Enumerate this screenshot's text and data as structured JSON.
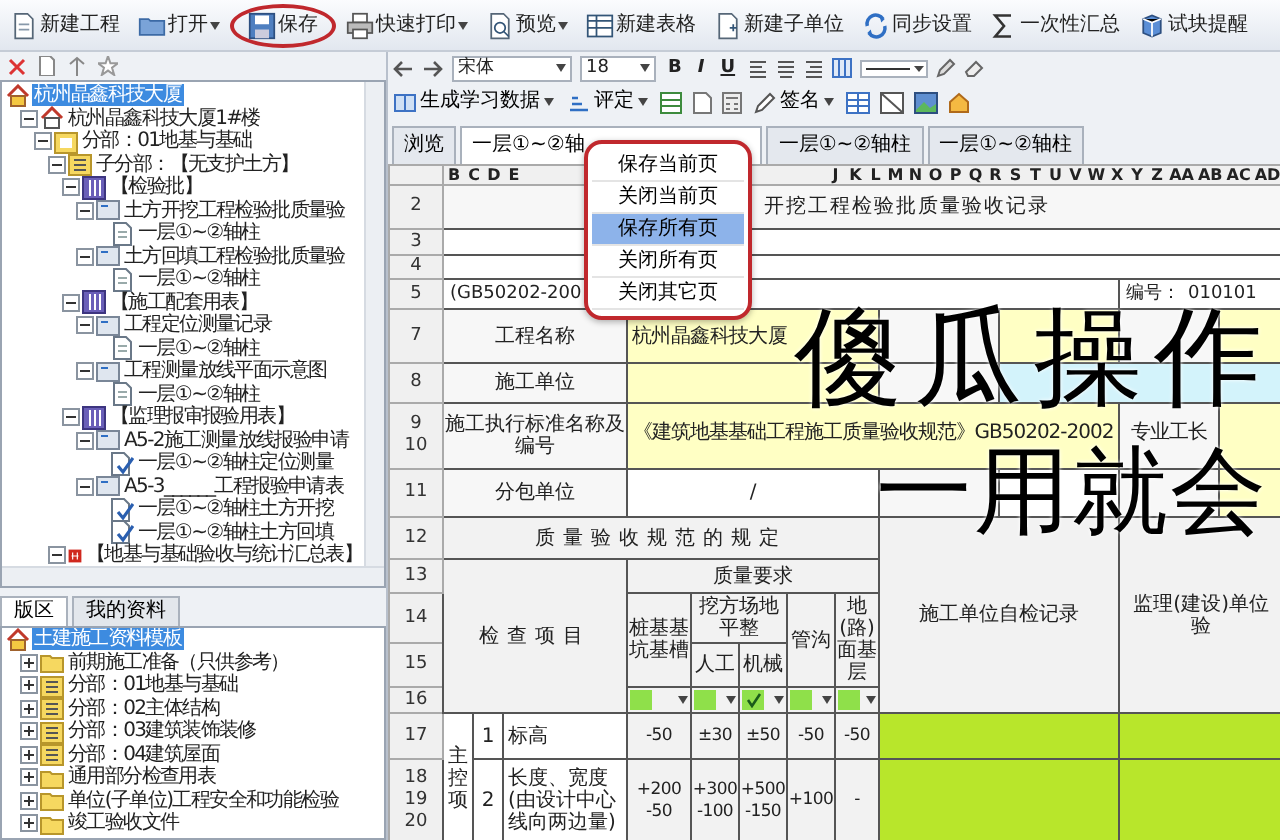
{
  "toolbar": [
    {
      "kind": "new-project",
      "label": "新建工程",
      "dropdown": false,
      "selected": false
    },
    {
      "kind": "open",
      "label": "打开",
      "dropdown": true,
      "selected": false
    },
    {
      "kind": "save",
      "label": "保存",
      "dropdown": false,
      "selected": true
    },
    {
      "kind": "print",
      "label": "快速打印",
      "dropdown": true,
      "selected": false
    },
    {
      "kind": "preview",
      "label": "预览",
      "dropdown": true,
      "selected": false
    },
    {
      "kind": "new-table",
      "label": "新建表格",
      "dropdown": false,
      "selected": false
    },
    {
      "kind": "new-unit",
      "label": "新建子单位",
      "dropdown": false,
      "selected": false
    },
    {
      "kind": "sync",
      "label": "同步设置",
      "dropdown": false,
      "selected": false
    },
    {
      "kind": "sum",
      "label": "一次性汇总",
      "dropdown": false,
      "selected": false
    },
    {
      "kind": "reminder",
      "label": "试块提醒",
      "dropdown": false,
      "selected": false
    }
  ],
  "format_bar": {
    "font": "宋体",
    "size": "18",
    "style_buttons": [
      "B",
      "I",
      "U"
    ]
  },
  "action_bar": [
    {
      "label": "生成学习数据",
      "dropdown": true
    },
    {
      "label": "评定",
      "dropdown": true
    },
    {
      "label": "签名",
      "dropdown": true
    }
  ],
  "project_tree": [
    {
      "label": "杭州晶鑫科技大厦",
      "kind": "root",
      "selected": true,
      "children": [
        {
          "label": "杭州晶鑫科技大厦1#楼",
          "kind": "building",
          "selected": false,
          "expanded": true,
          "children": [
            {
              "label": "分部：01地基与基础",
              "kind": "division",
              "selected": false,
              "expanded": true,
              "children": [
                {
                  "label": "子分部：【无支护土方】",
                  "kind": "subdivision",
                  "selected": false,
                  "expanded": true,
                  "children": [
                    {
                      "label": "【检验批】",
                      "kind": "group",
                      "selected": false,
                      "expanded": true,
                      "children": [
                        {
                          "label": "土方开挖工程检验批质量验",
                          "kind": "form",
                          "selected": false,
                          "expanded": true,
                          "children": [
                            {
                              "label": "一层①~②轴柱",
                              "kind": "sheet",
                              "selected": false
                            }
                          ]
                        },
                        {
                          "label": "土方回填工程检验批质量验",
                          "kind": "form",
                          "selected": false,
                          "expanded": true,
                          "children": [
                            {
                              "label": "一层①~②轴柱",
                              "kind": "sheet",
                              "selected": false
                            }
                          ]
                        }
                      ]
                    },
                    {
                      "label": "【施工配套用表】",
                      "kind": "group",
                      "selected": false,
                      "expanded": true,
                      "children": [
                        {
                          "label": "工程定位测量记录",
                          "kind": "form",
                          "selected": false,
                          "expanded": true,
                          "children": [
                            {
                              "label": "一层①~②轴柱",
                              "kind": "sheet",
                              "selected": false
                            }
                          ]
                        },
                        {
                          "label": "工程测量放线平面示意图",
                          "kind": "form",
                          "selected": false,
                          "expanded": true,
                          "children": [
                            {
                              "label": "一层①~②轴柱",
                              "kind": "sheet",
                              "selected": false
                            }
                          ]
                        }
                      ]
                    },
                    {
                      "label": "【监理报审报验用表】",
                      "kind": "group",
                      "selected": false,
                      "expanded": true,
                      "children": [
                        {
                          "label": "A5-2施工测量放线报验申请",
                          "kind": "form",
                          "selected": false,
                          "expanded": true,
                          "children": [
                            {
                              "label": "一层①~②轴柱定位测量",
                              "kind": "signed",
                              "selected": false
                            }
                          ]
                        },
                        {
                          "label": "A5-3______工程报验申请表",
                          "kind": "form",
                          "selected": false,
                          "expanded": true,
                          "children": [
                            {
                              "label": "一层①~②轴柱土方开挖",
                              "kind": "signed",
                              "selected": false
                            },
                            {
                              "label": "一层①~②轴柱土方回填",
                              "kind": "signed",
                              "selected": false
                            }
                          ]
                        }
                      ]
                    }
                  ]
                },
                {
                  "label": "【地基与基础验收与统计汇总表】",
                  "kind": "summary",
                  "selected": false,
                  "expanded": true
                }
              ]
            }
          ]
        }
      ]
    }
  ],
  "template_panel": {
    "tabs": [
      {
        "label": "版区",
        "selected": true
      },
      {
        "label": "我的资料",
        "selected": false
      }
    ],
    "items": [
      {
        "label": "土建施工资料模板",
        "kind": "root",
        "selected": true,
        "children": [
          {
            "label": "前期施工准备（只供参考）",
            "kind": "folder",
            "selected": false,
            "expanded": false
          },
          {
            "label": "分部：01地基与基础",
            "kind": "subdivision",
            "selected": false,
            "expanded": false
          },
          {
            "label": "分部：02主体结构",
            "kind": "subdivision",
            "selected": false,
            "expanded": false
          },
          {
            "label": "分部：03建筑装饰装修",
            "kind": "subdivision",
            "selected": false,
            "expanded": false
          },
          {
            "label": "分部：04建筑屋面",
            "kind": "subdivision",
            "selected": false,
            "expanded": false
          },
          {
            "label": "通用部分检查用表",
            "kind": "folder",
            "selected": false,
            "expanded": false
          },
          {
            "label": "单位(子单位)工程安全和功能检验",
            "kind": "folder",
            "selected": false,
            "expanded": false
          },
          {
            "label": "竣工验收文件",
            "kind": "folder",
            "selected": false,
            "expanded": false
          }
        ]
      }
    ]
  },
  "sheet_tabs": [
    {
      "label": "浏览",
      "selected": false
    },
    {
      "label": "一层①~②轴",
      "selected": true
    },
    {
      "label": "一层①~②轴柱",
      "selected": false
    },
    {
      "label": "一层①~②轴柱",
      "selected": false
    }
  ],
  "tab_menu": [
    {
      "label": "保存当前页",
      "selected": false
    },
    {
      "label": "关闭当前页",
      "selected": false
    },
    {
      "label": "保存所有页",
      "selected": true
    },
    {
      "label": "关闭所有页",
      "selected": false
    },
    {
      "label": "关闭其它页",
      "selected": false
    }
  ],
  "sheet": {
    "column_letters_left": [
      "B",
      "C",
      "D",
      "E"
    ],
    "column_letters_right": [
      "J",
      "K",
      "L",
      "M",
      "N",
      "O",
      "P",
      "Q",
      "R",
      "S",
      "T",
      "U",
      "V",
      "W",
      "X",
      "Y",
      "Z",
      "AA",
      "AB",
      "AC",
      "AD"
    ],
    "title": {
      "row": "2",
      "text": "开挖工程检验批质量验收记录"
    },
    "blank_rows": [
      "3",
      "4"
    ],
    "standard": {
      "row": "5",
      "text": "(GB50202-200",
      "code_label": "编号：",
      "code": "010101"
    },
    "info_rows": [
      {
        "rows": [
          "7"
        ],
        "cells": [
          {
            "kind": "label",
            "text": "工程名称"
          },
          {
            "kind": "input",
            "text": "杭州晶鑫科技大厦"
          },
          {
            "kind": "label"
          },
          {
            "kind": "input"
          },
          {
            "kind": "label"
          },
          {
            "kind": "input"
          }
        ]
      },
      {
        "rows": [
          "8"
        ],
        "cells": [
          {
            "kind": "label",
            "text": "施工单位"
          },
          {
            "kind": "input"
          },
          {
            "kind": "label"
          },
          {
            "kind": "location"
          }
        ]
      },
      {
        "rows": [
          "9",
          "10"
        ],
        "cells": [
          {
            "kind": "label",
            "text": "施工执行标准名称及编号"
          },
          {
            "kind": "input",
            "text": "《建筑地基基础工程施工质量验收规范》GB50202-2002"
          },
          {
            "kind": "label",
            "text": "专业工长"
          },
          {
            "kind": "input"
          }
        ]
      },
      {
        "rows": [
          "11"
        ],
        "cells": [
          {
            "kind": "label",
            "text": "分包单位"
          },
          {
            "kind": "blank",
            "text": "/"
          },
          {
            "kind": "label"
          },
          {
            "kind": "blank"
          },
          {
            "kind": "label"
          },
          {
            "kind": "input"
          }
        ]
      }
    ],
    "spec": {
      "rows": [
        "12",
        "13",
        "14",
        "15",
        "16"
      ],
      "section": "质量验收规范的规定",
      "check_item": "检查项目",
      "requirement": "质量要求",
      "pile": "桩基基坑基槽",
      "grading": "挖方场地平整",
      "manual": "人工",
      "machine": "机械",
      "trench": "管沟",
      "base": "地(路)面基层",
      "contractor": "施工单位自检记录",
      "supervisor": "监理(建设)单位验"
    },
    "dropdowns": [
      {
        "checked": false
      },
      {
        "checked": false
      },
      {
        "checked": true
      },
      {
        "checked": false
      },
      {
        "checked": false
      }
    ],
    "group": "主控项",
    "items": [
      {
        "rows": [
          "17"
        ],
        "no": "1",
        "name": "标高",
        "values": [
          "-50",
          "±30",
          "±50",
          "-50",
          "-50"
        ]
      },
      {
        "rows": [
          "18",
          "19",
          "20"
        ],
        "no": "2",
        "name": "长度、宽度(由设计中心线向两边量)",
        "values": [
          "+200 -50",
          "+300 -100",
          "+500 -150",
          "+100",
          "-"
        ]
      }
    ]
  },
  "caption": [
    "傻瓜操作",
    "一用就会"
  ]
}
